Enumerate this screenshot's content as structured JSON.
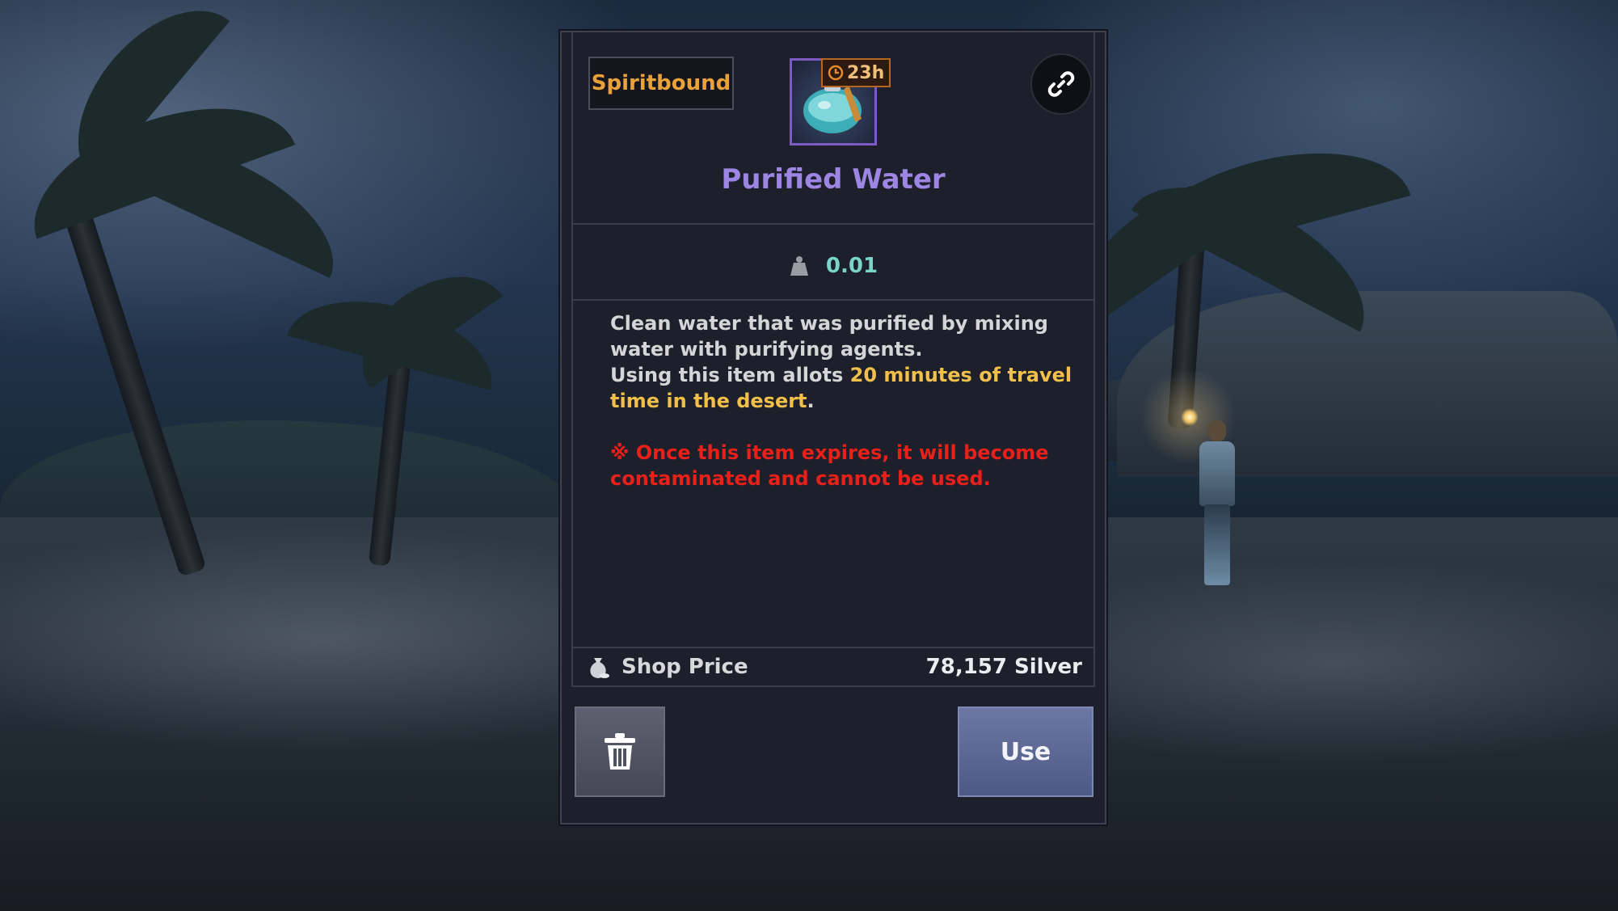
{
  "item": {
    "bound_label": "Spiritbound",
    "name": "Purified Water",
    "timer": "23h",
    "weight": "0.01",
    "description_line1": "Clean water that was purified by mixing water with purifying agents.",
    "description_prefix": "Using this item allots ",
    "description_highlight": "20 minutes of travel time in the desert",
    "description_suffix": ".",
    "warning": "※ Once this item expires, it will become contaminated and cannot be used.",
    "price_label": "Shop Price",
    "price_value": "78,157 Silver"
  },
  "actions": {
    "use_label": "Use"
  },
  "icons": {
    "link": "link-icon",
    "discard": "trash-icon",
    "weight": "weight-icon",
    "price": "silver-bag-icon",
    "timer": "clock-icon",
    "item": "water-flask-icon"
  },
  "colors": {
    "item_name": "#9d86e3",
    "bound": "#e9a23a",
    "highlight": "#f0c04a",
    "warning": "#e8201a",
    "weight_value": "#79d5c7",
    "use_button": "#5d6894"
  }
}
